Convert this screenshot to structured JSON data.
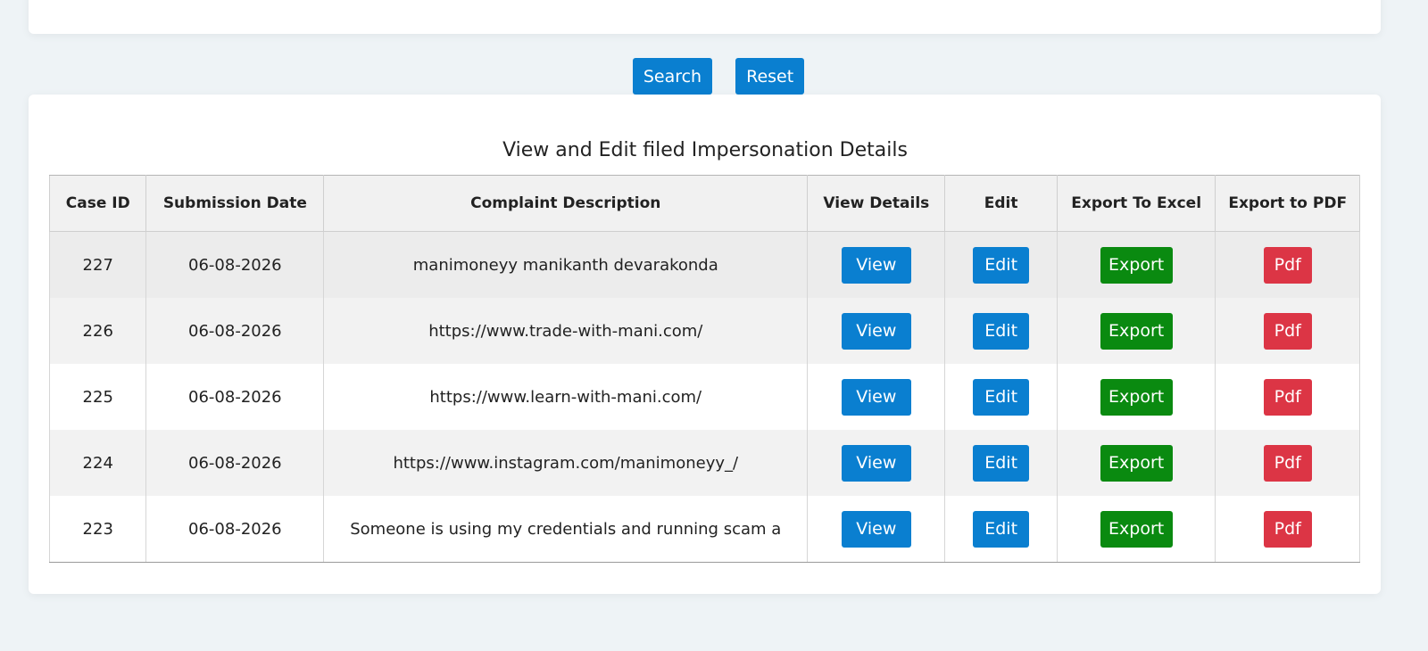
{
  "actions": {
    "search_label": "Search",
    "reset_label": "Reset"
  },
  "table": {
    "title": "View and Edit filed Impersonation Details",
    "headers": [
      "Case ID",
      "Submission Date",
      "Complaint Description",
      "View Details",
      "Edit",
      "Export To Excel",
      "Export to PDF"
    ],
    "rows": [
      {
        "case_id": "227",
        "date": "06-08-2026",
        "description": "manimoneyy manikanth devarakonda",
        "view": "View",
        "edit": "Edit",
        "export": "Export",
        "pdf": "Pdf"
      },
      {
        "case_id": "226",
        "date": "06-08-2026",
        "description": "https://www.trade-with-mani.com/",
        "view": "View",
        "edit": "Edit",
        "export": "Export",
        "pdf": "Pdf"
      },
      {
        "case_id": "225",
        "date": "06-08-2026",
        "description": "https://www.learn-with-mani.com/",
        "view": "View",
        "edit": "Edit",
        "export": "Export",
        "pdf": "Pdf"
      },
      {
        "case_id": "224",
        "date": "06-08-2026",
        "description": "https://www.instagram.com/manimoneyy_/",
        "view": "View",
        "edit": "Edit",
        "export": "Export",
        "pdf": "Pdf"
      },
      {
        "case_id": "223",
        "date": "06-08-2026",
        "description": "Someone is using my credentials and running scam a",
        "view": "View",
        "edit": "Edit",
        "export": "Export",
        "pdf": "Pdf"
      }
    ]
  },
  "colors": {
    "primary": "#0a7fd0",
    "success": "#0a8a10",
    "danger": "#dc3545",
    "background": "#eef3f6"
  }
}
